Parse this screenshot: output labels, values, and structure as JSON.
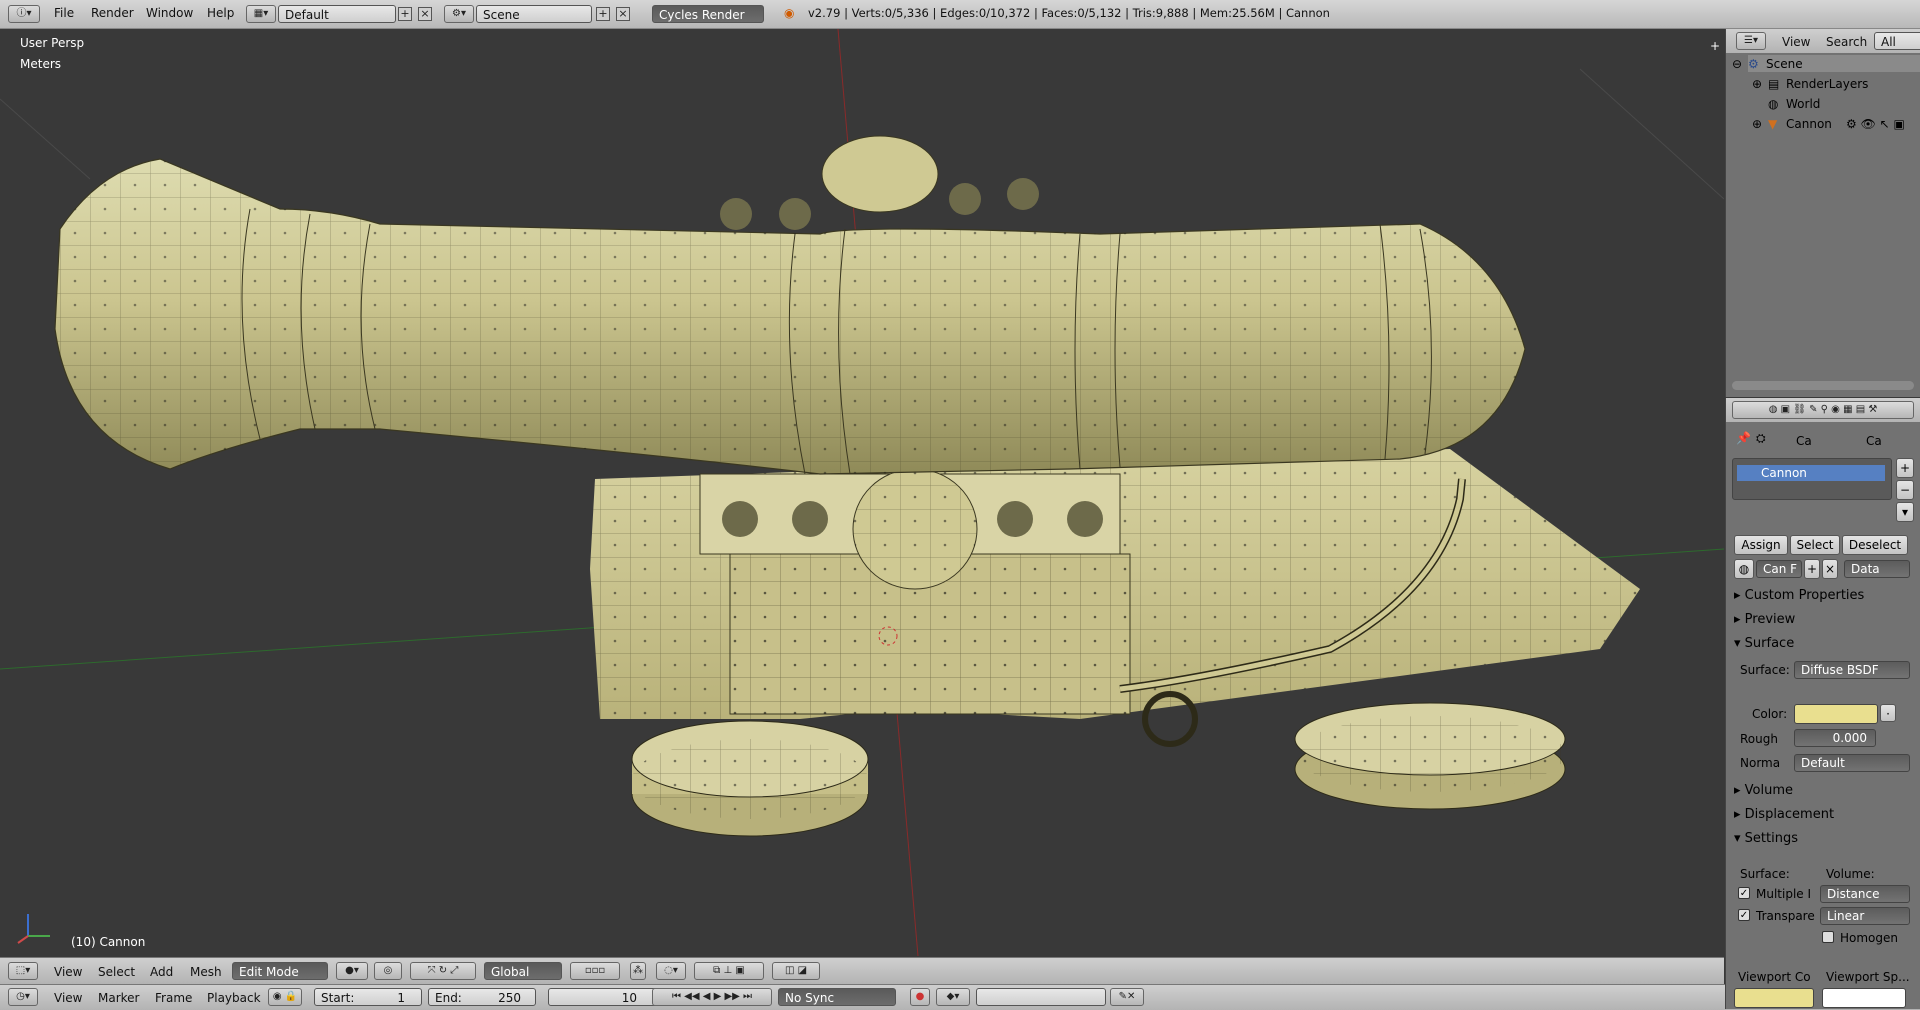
{
  "top": {
    "menu": [
      "File",
      "Render",
      "Window",
      "Help"
    ],
    "layout": "Default",
    "scene": "Scene",
    "engine": "Cycles Render",
    "stats": "v2.79 | Verts:0/5,336 | Edges:0/10,372 | Faces:0/5,132 | Tris:9,888 | Mem:25.56M | Cannon"
  },
  "viewport": {
    "persp": "User Persp",
    "units": "Meters",
    "object_label": "(10) Cannon"
  },
  "view_header": {
    "menus": [
      "View",
      "Select",
      "Add",
      "Mesh"
    ],
    "mode": "Edit Mode",
    "orientation": "Global"
  },
  "timeline": {
    "menus": [
      "View",
      "Marker",
      "Frame",
      "Playback"
    ],
    "start_label": "Start:",
    "start": "1",
    "end_label": "End:",
    "end": "250",
    "current": "10",
    "sync": "No Sync"
  },
  "outliner": {
    "header_menus": [
      "View",
      "Search",
      "All Scenes"
    ],
    "items": [
      {
        "label": "Scene"
      },
      {
        "label": "RenderLayers"
      },
      {
        "label": "World"
      },
      {
        "label": "Cannon"
      }
    ]
  },
  "properties": {
    "breadcrumb": [
      "Ca",
      "Ca"
    ],
    "material_slot": "Cannon",
    "assign": "Assign",
    "select": "Select",
    "deselect": "Deselect",
    "material_name": "Can",
    "f_label": "F",
    "data_drop": "Data",
    "sections": {
      "custom": "Custom Properties",
      "preview": "Preview",
      "surface": "Surface",
      "volume": "Volume",
      "displacement": "Displacement",
      "settings": "Settings"
    },
    "surface_label": "Surface:",
    "surface_value": "Diffuse BSDF",
    "color_label": "Color:",
    "color_value": "#e9df8f",
    "rough_label": "Rough",
    "rough_value": "0.000",
    "normal_label": "Norma",
    "normal_value": "Default",
    "settings_surface": "Surface:",
    "settings_volume": "Volume:",
    "multiple": "Multiple I",
    "distance": "Distance",
    "transparent": "Transpare",
    "linear": "Linear",
    "homogen": "Homogen",
    "viewport_color": "Viewport Co",
    "viewport_spec": "Viewport Sp..."
  }
}
